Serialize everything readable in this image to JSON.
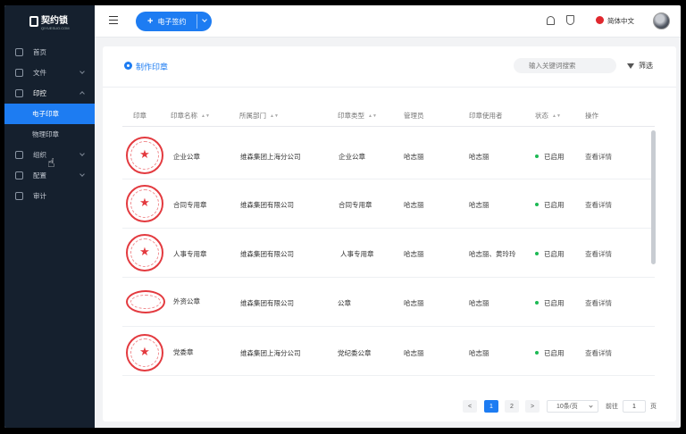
{
  "sidebar": {
    "logo": "契约锁",
    "logo_sub": "QIYUESUO.COM",
    "items": [
      {
        "label": "首页"
      },
      {
        "label": "文件"
      },
      {
        "label": "印控"
      },
      {
        "label": "电子印章"
      },
      {
        "label": "物理印章"
      },
      {
        "label": "组织"
      },
      {
        "label": "配置"
      },
      {
        "label": "审计"
      }
    ]
  },
  "topbar": {
    "new_button": "电子签约",
    "language": "简体中文"
  },
  "main": {
    "title": "制作印章",
    "search_placeholder": "输入关键词搜索",
    "filter_label": "筛选",
    "columns": [
      "印章",
      "印章名称",
      "所属部门",
      "印章类型",
      "管理员",
      "印章使用者",
      "状态",
      "操作"
    ],
    "rows": [
      {
        "name": "企业公章",
        "dept": "维森集团上海分公司",
        "type": "企业公章",
        "admin": "哈志丽",
        "users": "哈志丽",
        "status": "已启用",
        "action": "查看详情"
      },
      {
        "name": "合同专用章",
        "dept": "维森集团有限公司",
        "type": "合同专用章",
        "admin": "哈志丽",
        "users": "哈志丽",
        "status": "已启用",
        "action": "查看详情"
      },
      {
        "name": "人事专用章",
        "dept": "维森集团有限公司",
        "type": "人事专用章",
        "admin": "哈志丽",
        "users": "哈志丽、黄玲玲",
        "status": "已启用",
        "action": "查看详情"
      },
      {
        "name": "外资公章",
        "dept": "维森集团有限公司",
        "type": "公章",
        "admin": "哈志丽",
        "users": "哈志丽",
        "status": "已启用",
        "action": "查看详情"
      },
      {
        "name": "党委章",
        "dept": "维森集团上海分公司",
        "type": "党纪委公章",
        "admin": "哈志丽",
        "users": "哈志丽",
        "status": "已启用",
        "action": "查看详情"
      }
    ]
  },
  "pagination": {
    "prev": "<",
    "pages": [
      "1",
      "2"
    ],
    "next": ">",
    "page_size": "10条/页",
    "goto_label": "前往",
    "goto_value": "1",
    "page_unit": "页"
  },
  "colors": {
    "accent": "#1d7cf2",
    "sidebar_bg": "#15202e",
    "seal_red": "#e33a3f",
    "status_green": "#1db954"
  }
}
